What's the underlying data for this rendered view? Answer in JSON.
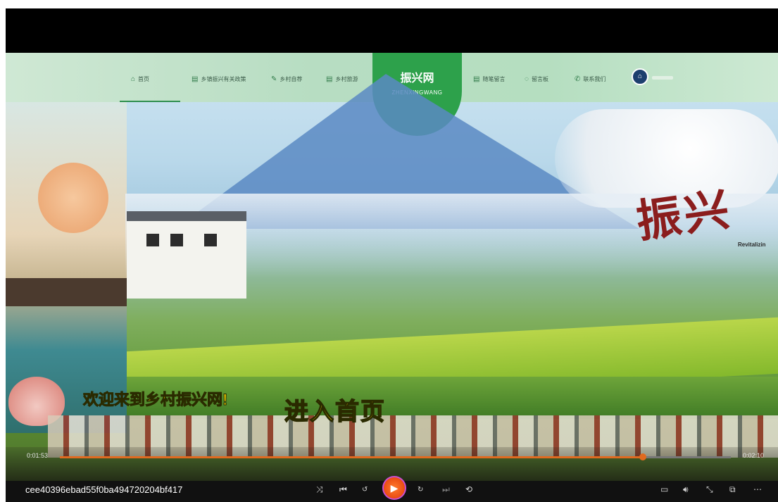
{
  "nav": {
    "items": [
      {
        "label": "首页",
        "icon": "home-icon"
      },
      {
        "label": "乡镇振兴有关政策",
        "icon": "document-icon"
      },
      {
        "label": "乡村自荐",
        "icon": "pencil-icon"
      },
      {
        "label": "乡村旅游",
        "icon": "document-icon"
      },
      {
        "label": "随笔留言",
        "icon": "document-icon"
      },
      {
        "label": "留言板",
        "icon": "chat-icon"
      },
      {
        "label": "联系我们",
        "icon": "phone-icon"
      }
    ],
    "logo": {
      "title": "振兴网",
      "subtitle": "ZHENXINGWANG"
    },
    "user_icon": "user-avatar-icon"
  },
  "banner": {
    "calligraphy": "振兴",
    "english": "Revitalizin"
  },
  "overlay": {
    "welcome": "欢迎来到乡村振兴网!",
    "enter": "进入首页"
  },
  "player": {
    "current_time": "0:01:53",
    "total_time": "0:02:10",
    "progress": 0.869,
    "video_id": "cee40396ebad55f0ba494720204bf417",
    "accent": "#e06a1f",
    "controls": {
      "shuffle": "shuffle-icon",
      "previous": "previous-icon",
      "rewind": "rewind-10-icon",
      "play": "play-icon",
      "forward": "forward-30-icon",
      "next": "next-icon",
      "repeat": "repeat-icon",
      "subtitles": "subtitles-icon",
      "volume": "volume-icon",
      "minimize": "minimize-icon",
      "miniplayer": "miniplayer-icon",
      "more": "more-icon"
    }
  }
}
